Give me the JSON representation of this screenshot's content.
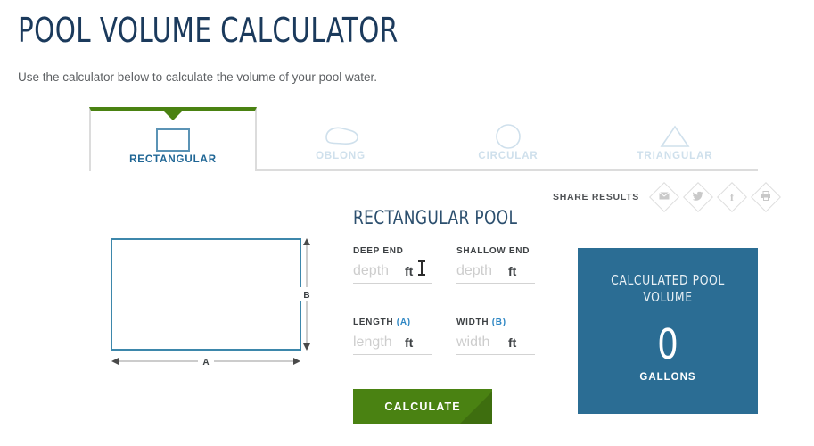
{
  "header": {
    "title": "POOL VOLUME CALCULATOR",
    "subtitle": "Use the calculator below to calculate the volume of your pool water."
  },
  "tabs": [
    {
      "id": "rectangular",
      "label": "RECTANGULAR",
      "icon": "rectangle-icon",
      "active": true
    },
    {
      "id": "oblong",
      "label": "OBLONG",
      "icon": "oblong-icon",
      "active": false
    },
    {
      "id": "circular",
      "label": "CIRCULAR",
      "icon": "circle-icon",
      "active": false
    },
    {
      "id": "triangular",
      "label": "TRIANGULAR",
      "icon": "triangle-icon",
      "active": false
    }
  ],
  "share": {
    "label": "SHARE RESULTS",
    "items": [
      {
        "id": "email",
        "icon": "envelope-icon",
        "glyph": "✉"
      },
      {
        "id": "twitter",
        "icon": "twitter-bird-icon",
        "glyph": "🐦"
      },
      {
        "id": "facebook",
        "icon": "facebook-icon",
        "glyph": "f"
      },
      {
        "id": "print",
        "icon": "printer-icon",
        "glyph": "⎙"
      }
    ]
  },
  "diagram": {
    "name": "rectangular-pool-diagram",
    "width_label": "A",
    "height_label": "B",
    "shape_stroke": "#3d87ab",
    "arrow_color": "#4a4a4a"
  },
  "form": {
    "title": "RECTANGULAR POOL",
    "fields": [
      {
        "id": "deep-end",
        "label": "DEEP END",
        "dim": "",
        "placeholder": "depth",
        "value": "",
        "unit": "ft",
        "focused": true
      },
      {
        "id": "shallow-end",
        "label": "SHALLOW END",
        "dim": "",
        "placeholder": "depth",
        "value": "",
        "unit": "ft",
        "focused": false
      },
      {
        "id": "length",
        "label": "LENGTH",
        "dim": "(A)",
        "placeholder": "length",
        "value": "",
        "unit": "ft",
        "focused": false
      },
      {
        "id": "width",
        "label": "WIDTH",
        "dim": "(B)",
        "placeholder": "width",
        "value": "",
        "unit": "ft",
        "focused": false
      }
    ],
    "calculate_label": "CALCULATE"
  },
  "result": {
    "heading": "CALCULATED POOL VOLUME",
    "value": "0",
    "unit": "GALLONS"
  },
  "colors": {
    "navy": "#1b3a5c",
    "accent_blue": "#1f6695",
    "light_blue": "#cfe0ec",
    "green": "#4a8212",
    "green_dark": "#3e6e0f",
    "panel_blue": "#2b6d94",
    "border_gray": "#dcdcdc"
  }
}
